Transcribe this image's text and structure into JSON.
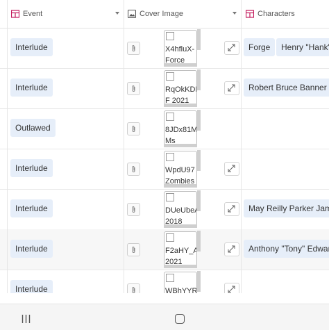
{
  "header": {
    "event_label": "Event",
    "cover_label": "Cover Image",
    "characters_label": "Characters"
  },
  "rows": [
    {
      "event": "Interlude",
      "image_name": "X4hfluX-",
      "image_caption": "Force",
      "characters": [
        "Forge",
        "Henry \"Hank\""
      ]
    },
    {
      "event": "Interlude",
      "image_name": "RqOkKDI",
      "image_caption": "F 2021",
      "characters": [
        "Robert Bruce Banner \""
      ]
    },
    {
      "event": "Outlawed",
      "image_name": "8JDx81M",
      "image_caption": "Ms",
      "characters": []
    },
    {
      "event": "Interlude",
      "image_name": "WpdU97",
      "image_caption": "Zombies",
      "characters": []
    },
    {
      "event": "Interlude",
      "image_name": "DUeUbeA",
      "image_caption": "2018",
      "characters": [
        "May Reilly Parker Jam"
      ]
    },
    {
      "event": "Interlude",
      "image_name": "F2aHY_A",
      "image_caption": "2021",
      "characters": [
        "Anthony \"Tony\" Edwar"
      ]
    },
    {
      "event": "Interlude",
      "image_name": "WBhYYR",
      "image_caption": "",
      "characters": []
    }
  ],
  "icons": {
    "event_header": "table-icon",
    "cover_header": "image-icon",
    "characters_header": "table-icon",
    "attach": "paperclip-icon",
    "expand": "expand-icon",
    "nav_recent": "recent-apps-icon",
    "nav_home": "home-icon"
  },
  "colors": {
    "pill_bg": "#e6eef9",
    "table_icon": "#c2185b"
  }
}
